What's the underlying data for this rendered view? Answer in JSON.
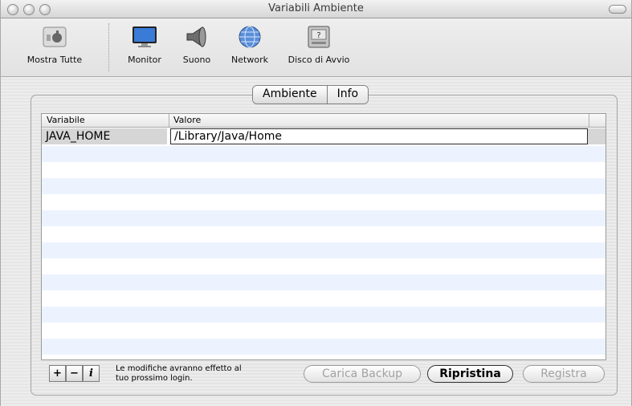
{
  "window": {
    "title": "Variabili Ambiente"
  },
  "toolbar": {
    "items": [
      {
        "label": "Mostra Tutte",
        "icon": "apple-prefs-icon"
      },
      {
        "label": "Monitor",
        "icon": "monitor-icon"
      },
      {
        "label": "Suono",
        "icon": "speaker-icon"
      },
      {
        "label": "Network",
        "icon": "globe-icon"
      },
      {
        "label": "Disco di Avvio",
        "icon": "startup-disk-icon"
      }
    ]
  },
  "tabs": [
    {
      "label": "Ambiente"
    },
    {
      "label": "Info"
    }
  ],
  "table": {
    "columns": [
      "Variabile",
      "Valore"
    ],
    "rows": [
      {
        "variable": "JAVA_HOME",
        "value": "/Library/Java/Home"
      }
    ]
  },
  "footer": {
    "add": "+",
    "remove": "−",
    "info": "i",
    "note_line1": "Le modifiche avranno effetto al",
    "note_line2": "tuo prossimo login.",
    "buttons": {
      "load_backup": "Carica Backup",
      "restore": "Ripristina",
      "save": "Registra"
    }
  }
}
